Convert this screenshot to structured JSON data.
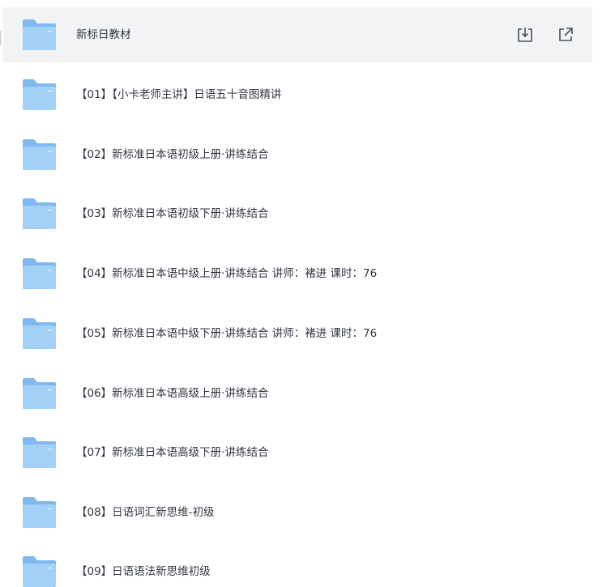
{
  "items": [
    {
      "label": "新标日教材",
      "highlighted": true
    },
    {
      "label": "【01】【小卡老师主讲】日语五十音图精讲"
    },
    {
      "label": "【02】新标准日本语初级上册·讲练结合"
    },
    {
      "label": "【03】新标准日本语初级下册·讲练结合"
    },
    {
      "label": "【04】新标准日本语中级上册·讲练结合 讲师：褚进 课时：76"
    },
    {
      "label": "【05】新标准日本语中级下册·讲练结合 讲师：褚进 课时：76"
    },
    {
      "label": "【06】新标准日本语高级上册·讲练结合"
    },
    {
      "label": "【07】新标准日本语高级下册·讲练结合"
    },
    {
      "label": "【08】日语词汇新思维-初级"
    },
    {
      "label": "【09】日语语法新思维初级"
    }
  ],
  "row_actions": {
    "download_icon": "download-icon",
    "share_icon": "share-icon"
  },
  "colors": {
    "highlight_bg": "#f2f3f5",
    "folder_main": "#a3d0f7",
    "folder_tab": "#7fb9ef",
    "text": "#333743",
    "icon": "#4a4f5c"
  }
}
